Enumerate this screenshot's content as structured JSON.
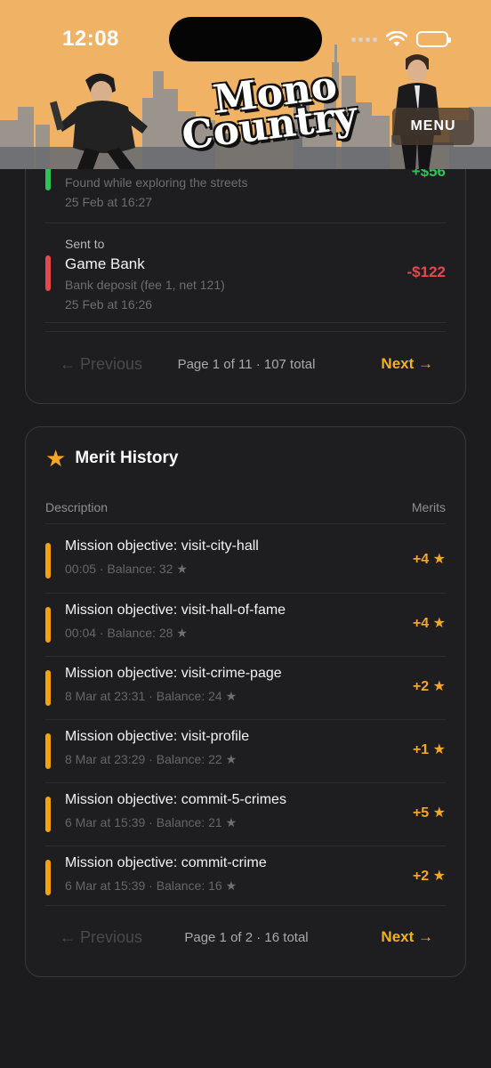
{
  "status_bar": {
    "time": "12:08"
  },
  "header": {
    "logo_line1": "Mono",
    "logo_line2": "Country",
    "menu_label": "MENU"
  },
  "transactions": {
    "partial_top": {
      "amount": "+$56",
      "description": "Found while exploring the streets",
      "date": "25 Feb at 16:27",
      "color": "#2fc25b"
    },
    "items": [
      {
        "label": "Sent to",
        "name": "Game Bank",
        "description": "Bank deposit (fee 1, net 121)",
        "date": "25 Feb at 16:26",
        "amount": "-$122",
        "color": "#e5484d"
      }
    ],
    "pagination": {
      "prev": "← Previous",
      "info": "Page 1 of 11 · 107 total",
      "next": "Next →"
    }
  },
  "merits": {
    "title": "Merit History",
    "columns": {
      "description": "Description",
      "merits": "Merits"
    },
    "rows": [
      {
        "description": "Mission objective: visit-city-hall",
        "time": "00:05",
        "balance": "Balance: 32",
        "merits": "+4"
      },
      {
        "description": "Mission objective: visit-hall-of-fame",
        "time": "00:04",
        "balance": "Balance: 28",
        "merits": "+4"
      },
      {
        "description": "Mission objective: visit-crime-page",
        "time": "8 Mar at 23:31",
        "balance": "Balance: 24",
        "merits": "+2"
      },
      {
        "description": "Mission objective: visit-profile",
        "time": "8 Mar at 23:29",
        "balance": "Balance: 22",
        "merits": "+1"
      },
      {
        "description": "Mission objective: commit-5-crimes",
        "time": "6 Mar at 15:39",
        "balance": "Balance: 21",
        "merits": "+5"
      },
      {
        "description": "Mission objective: commit-crime",
        "time": "6 Mar at 15:39",
        "balance": "Balance: 16",
        "merits": "+2"
      }
    ],
    "pagination": {
      "prev": "← Previous",
      "info": "Page 1 of 2 · 16 total",
      "next": "Next →"
    },
    "accent": "#f5a623"
  }
}
